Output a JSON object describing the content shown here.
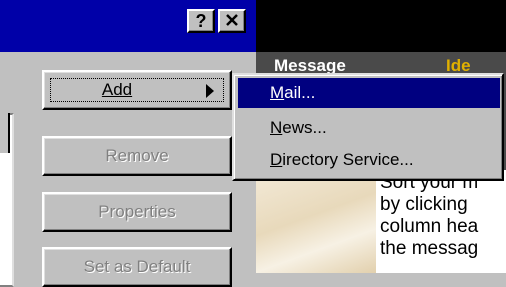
{
  "titlebar": {
    "help_label": "?",
    "close_icon": "close-x-icon"
  },
  "buttons": {
    "add_label": "Add",
    "add_mnemonic": "A",
    "remove_label": "Remove",
    "properties_label": "Properties",
    "set_default_label": "Set as Default"
  },
  "submenu": {
    "items": [
      {
        "label": "Mail...",
        "selected": true
      },
      {
        "label": "News...",
        "selected": false
      },
      {
        "label": "Directory Service...",
        "selected": false
      }
    ]
  },
  "background": {
    "heading_left": "Message",
    "heading_right": "Ide",
    "text_lines": [
      "Sort your m",
      "by clicking",
      "column hea",
      "the messag"
    ]
  },
  "colors": {
    "title_bar": "#0000a8",
    "selection": "#000080",
    "face": "#c0c0c0"
  }
}
